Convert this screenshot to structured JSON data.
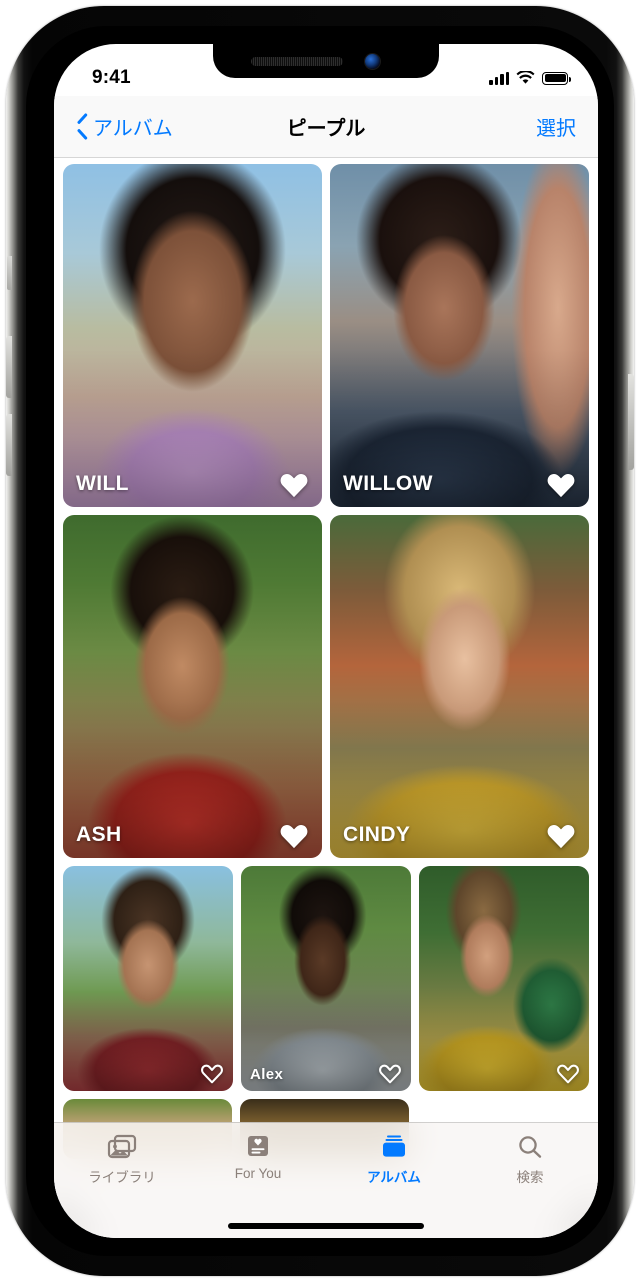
{
  "status_bar": {
    "time": "9:41",
    "signal_icon": "cellular-bars-icon",
    "wifi_icon": "wifi-icon",
    "battery_icon": "battery-full-icon"
  },
  "nav_bar": {
    "back_label": "アルバム",
    "back_icon": "chevron-left-icon",
    "title": "ピープル",
    "action_label": "選択"
  },
  "colors": {
    "accent": "#037aff",
    "nav_background": "#f9f9f9",
    "tab_inactive": "#8b807a",
    "tile_label": "#ffffff"
  },
  "people_grid": {
    "rows": [
      {
        "size": "large",
        "tiles": [
          {
            "name": "WILL",
            "favorite": true,
            "art": "p-will"
          },
          {
            "name": "WILLOW",
            "favorite": true,
            "art": "p-willow"
          }
        ]
      },
      {
        "size": "large",
        "tiles": [
          {
            "name": "ASH",
            "favorite": true,
            "art": "p-ash"
          },
          {
            "name": "CINDY",
            "favorite": true,
            "art": "p-cindy"
          }
        ]
      },
      {
        "size": "small",
        "tiles": [
          {
            "name": "",
            "favorite": false,
            "art": "p-long"
          },
          {
            "name": "Alex",
            "favorite": false,
            "art": "p-alex"
          },
          {
            "name": "",
            "favorite": false,
            "art": "p-two"
          }
        ]
      },
      {
        "size": "peek",
        "tiles": [
          {
            "name": "",
            "favorite": false,
            "art": "p-pk1"
          },
          {
            "name": "",
            "favorite": false,
            "art": "p-pk2"
          }
        ]
      }
    ]
  },
  "tab_bar": {
    "items": [
      {
        "label": "ライブラリ",
        "icon": "photos-library-icon",
        "active": false
      },
      {
        "label": "For You",
        "icon": "for-you-card-icon",
        "active": false
      },
      {
        "label": "アルバム",
        "icon": "albums-icon",
        "active": true
      },
      {
        "label": "検索",
        "icon": "search-icon",
        "active": false
      }
    ]
  }
}
